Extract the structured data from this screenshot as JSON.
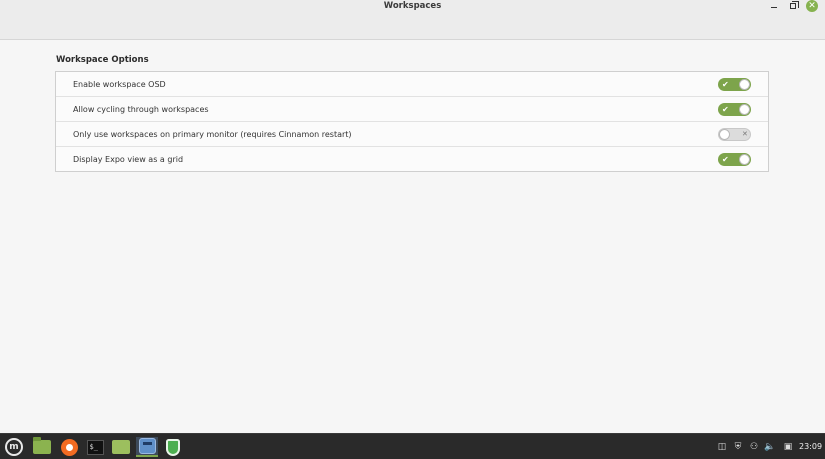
{
  "window": {
    "title": "Workspaces",
    "controls": {
      "minimize": "–",
      "maximize": "□",
      "close": "✕"
    }
  },
  "section": {
    "title": "Workspace Options",
    "rows": [
      {
        "label": "Enable workspace OSD",
        "enabled": true
      },
      {
        "label": "Allow cycling through workspaces",
        "enabled": true
      },
      {
        "label": "Only use workspaces on primary monitor (requires Cinnamon restart)",
        "enabled": false
      },
      {
        "label": "Display Expo view as a grid",
        "enabled": true
      }
    ],
    "switch_on_mark": "✔",
    "switch_off_mark": "✕"
  },
  "taskbar": {
    "apps": [
      "mint-menu-icon",
      "files-icon",
      "firefox-icon",
      "terminal-icon",
      "folder-icon",
      "system-settings-icon",
      "update-manager-icon"
    ],
    "terminal_glyph": "$_",
    "mint_glyph": "m",
    "tray": {
      "workspace_glyph": "◫",
      "shield_glyph": "⛨",
      "network_glyph": "⚇",
      "volume_glyph": "🔈",
      "clipboard_glyph": "▣"
    },
    "clock": "23:09"
  },
  "colors": {
    "accent": "#7da44b",
    "taskbar": "#2a2a2a",
    "window_bg": "#f6f6f6"
  }
}
